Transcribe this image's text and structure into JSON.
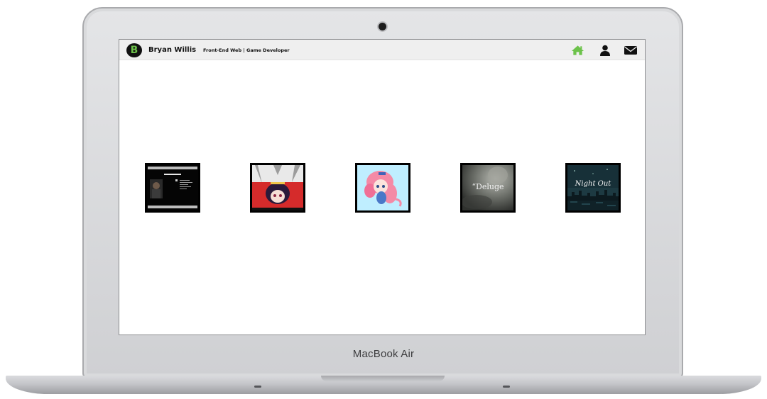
{
  "device": {
    "brand_label": "MacBook Air"
  },
  "site": {
    "logo_letter": "B",
    "name": "Bryan Willis",
    "tagline": "Front-End Web | Game Developer",
    "nav": [
      {
        "name": "home",
        "icon": "home-icon",
        "color": "#6cc24a",
        "active": true
      },
      {
        "name": "about",
        "icon": "user-icon",
        "color": "#111111",
        "active": false
      },
      {
        "name": "contact",
        "icon": "envelope-icon",
        "color": "#111111",
        "active": false
      }
    ]
  },
  "portfolio": {
    "items": [
      {
        "kind": "website-screenshot",
        "title": "Meet Bryan Willis"
      },
      {
        "kind": "anime-illustration"
      },
      {
        "kind": "pixel-character"
      },
      {
        "kind": "game-title",
        "title": "“Deluge"
      },
      {
        "kind": "game-title",
        "title": "Night Out"
      }
    ]
  },
  "colors": {
    "accent": "#6cc24a",
    "navbar_bg": "#efefef",
    "thumb_border": "#000000"
  }
}
